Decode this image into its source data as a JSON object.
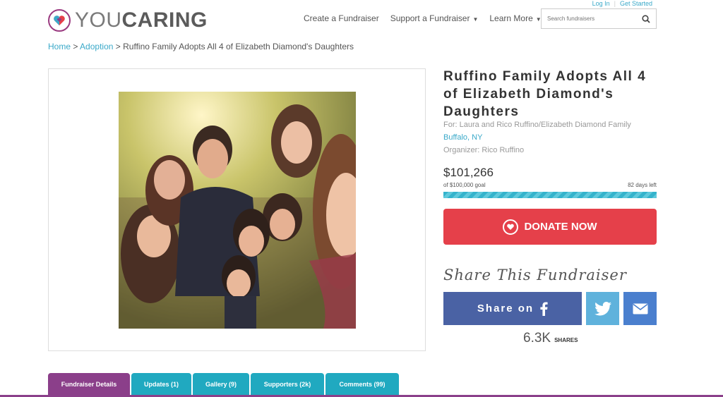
{
  "top_links": {
    "login": "Log In",
    "get_started": "Get Started"
  },
  "logo": {
    "you": "YOU",
    "caring": "CARING"
  },
  "nav": {
    "create": "Create a Fundraiser",
    "support": "Support a Fundraiser",
    "learn": "Learn More"
  },
  "search": {
    "placeholder": "Search fundraisers"
  },
  "breadcrumb": {
    "home": "Home",
    "sep": ">",
    "category": "Adoption",
    "current": "Ruffino Family Adopts All 4 of Elizabeth Diamond's Daughters"
  },
  "fundraiser": {
    "title": "Ruffino Family Adopts All 4 of Elizabeth Diamond's Daughters",
    "for": "For: Laura and Rico Ruffino/Elizabeth Diamond Family",
    "location": "Buffalo, NY",
    "organizer": "Organizer: Rico Ruffino",
    "raised": "$101,266",
    "goal": "of $100,000 goal",
    "days_left": "82 days left",
    "progress_fraction": 1.0
  },
  "donate": {
    "label": "DONATE NOW"
  },
  "share": {
    "heading": "Share This Fundraiser",
    "facebook_label": "Share on",
    "count": "6.3K",
    "count_label": "SHARES"
  },
  "tabs": [
    {
      "label": "Fundraiser Details"
    },
    {
      "label": "Updates (1)"
    },
    {
      "label": "Gallery (9)"
    },
    {
      "label": "Supporters (2k)"
    },
    {
      "label": "Comments (99)"
    }
  ],
  "colors": {
    "accent": "#3aa9c9",
    "donate": "#e5404a",
    "facebook": "#4a62a4",
    "twitter": "#5fb2dc",
    "email": "#4a7fce",
    "tab": "#20a9c0",
    "tab_active": "#8b3f8a"
  }
}
